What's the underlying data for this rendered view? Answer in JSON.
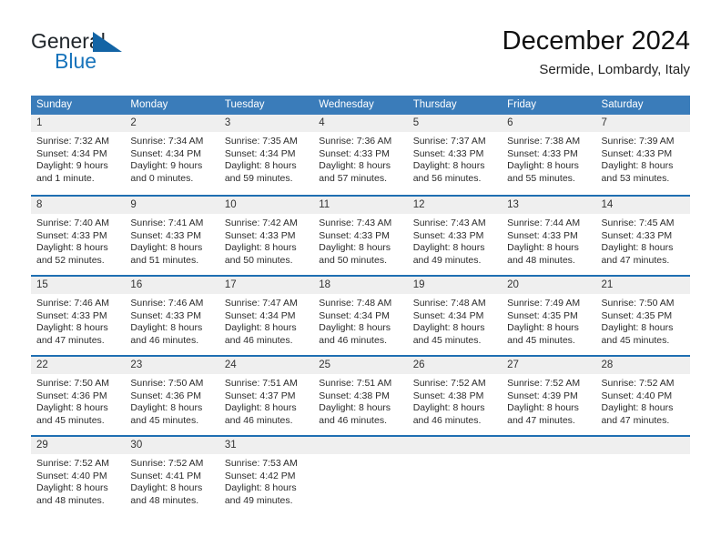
{
  "brand": {
    "name_part1": "General",
    "name_part2": "Blue",
    "mark_icon": "triangle-icon",
    "accent_color": "#1364a5"
  },
  "header": {
    "title": "December 2024",
    "subtitle": "Sermide, Lombardy, Italy"
  },
  "theme": {
    "header_row_bg": "#3a7cba",
    "row_divider": "#1f6fb2",
    "day_number_bg": "#efefef"
  },
  "weekdays": [
    "Sunday",
    "Monday",
    "Tuesday",
    "Wednesday",
    "Thursday",
    "Friday",
    "Saturday"
  ],
  "weeks": [
    [
      {
        "day": "1",
        "sunrise": "Sunrise: 7:32 AM",
        "sunset": "Sunset: 4:34 PM",
        "daylight1": "Daylight: 9 hours",
        "daylight2": "and 1 minute."
      },
      {
        "day": "2",
        "sunrise": "Sunrise: 7:34 AM",
        "sunset": "Sunset: 4:34 PM",
        "daylight1": "Daylight: 9 hours",
        "daylight2": "and 0 minutes."
      },
      {
        "day": "3",
        "sunrise": "Sunrise: 7:35 AM",
        "sunset": "Sunset: 4:34 PM",
        "daylight1": "Daylight: 8 hours",
        "daylight2": "and 59 minutes."
      },
      {
        "day": "4",
        "sunrise": "Sunrise: 7:36 AM",
        "sunset": "Sunset: 4:33 PM",
        "daylight1": "Daylight: 8 hours",
        "daylight2": "and 57 minutes."
      },
      {
        "day": "5",
        "sunrise": "Sunrise: 7:37 AM",
        "sunset": "Sunset: 4:33 PM",
        "daylight1": "Daylight: 8 hours",
        "daylight2": "and 56 minutes."
      },
      {
        "day": "6",
        "sunrise": "Sunrise: 7:38 AM",
        "sunset": "Sunset: 4:33 PM",
        "daylight1": "Daylight: 8 hours",
        "daylight2": "and 55 minutes."
      },
      {
        "day": "7",
        "sunrise": "Sunrise: 7:39 AM",
        "sunset": "Sunset: 4:33 PM",
        "daylight1": "Daylight: 8 hours",
        "daylight2": "and 53 minutes."
      }
    ],
    [
      {
        "day": "8",
        "sunrise": "Sunrise: 7:40 AM",
        "sunset": "Sunset: 4:33 PM",
        "daylight1": "Daylight: 8 hours",
        "daylight2": "and 52 minutes."
      },
      {
        "day": "9",
        "sunrise": "Sunrise: 7:41 AM",
        "sunset": "Sunset: 4:33 PM",
        "daylight1": "Daylight: 8 hours",
        "daylight2": "and 51 minutes."
      },
      {
        "day": "10",
        "sunrise": "Sunrise: 7:42 AM",
        "sunset": "Sunset: 4:33 PM",
        "daylight1": "Daylight: 8 hours",
        "daylight2": "and 50 minutes."
      },
      {
        "day": "11",
        "sunrise": "Sunrise: 7:43 AM",
        "sunset": "Sunset: 4:33 PM",
        "daylight1": "Daylight: 8 hours",
        "daylight2": "and 50 minutes."
      },
      {
        "day": "12",
        "sunrise": "Sunrise: 7:43 AM",
        "sunset": "Sunset: 4:33 PM",
        "daylight1": "Daylight: 8 hours",
        "daylight2": "and 49 minutes."
      },
      {
        "day": "13",
        "sunrise": "Sunrise: 7:44 AM",
        "sunset": "Sunset: 4:33 PM",
        "daylight1": "Daylight: 8 hours",
        "daylight2": "and 48 minutes."
      },
      {
        "day": "14",
        "sunrise": "Sunrise: 7:45 AM",
        "sunset": "Sunset: 4:33 PM",
        "daylight1": "Daylight: 8 hours",
        "daylight2": "and 47 minutes."
      }
    ],
    [
      {
        "day": "15",
        "sunrise": "Sunrise: 7:46 AM",
        "sunset": "Sunset: 4:33 PM",
        "daylight1": "Daylight: 8 hours",
        "daylight2": "and 47 minutes."
      },
      {
        "day": "16",
        "sunrise": "Sunrise: 7:46 AM",
        "sunset": "Sunset: 4:33 PM",
        "daylight1": "Daylight: 8 hours",
        "daylight2": "and 46 minutes."
      },
      {
        "day": "17",
        "sunrise": "Sunrise: 7:47 AM",
        "sunset": "Sunset: 4:34 PM",
        "daylight1": "Daylight: 8 hours",
        "daylight2": "and 46 minutes."
      },
      {
        "day": "18",
        "sunrise": "Sunrise: 7:48 AM",
        "sunset": "Sunset: 4:34 PM",
        "daylight1": "Daylight: 8 hours",
        "daylight2": "and 46 minutes."
      },
      {
        "day": "19",
        "sunrise": "Sunrise: 7:48 AM",
        "sunset": "Sunset: 4:34 PM",
        "daylight1": "Daylight: 8 hours",
        "daylight2": "and 45 minutes."
      },
      {
        "day": "20",
        "sunrise": "Sunrise: 7:49 AM",
        "sunset": "Sunset: 4:35 PM",
        "daylight1": "Daylight: 8 hours",
        "daylight2": "and 45 minutes."
      },
      {
        "day": "21",
        "sunrise": "Sunrise: 7:50 AM",
        "sunset": "Sunset: 4:35 PM",
        "daylight1": "Daylight: 8 hours",
        "daylight2": "and 45 minutes."
      }
    ],
    [
      {
        "day": "22",
        "sunrise": "Sunrise: 7:50 AM",
        "sunset": "Sunset: 4:36 PM",
        "daylight1": "Daylight: 8 hours",
        "daylight2": "and 45 minutes."
      },
      {
        "day": "23",
        "sunrise": "Sunrise: 7:50 AM",
        "sunset": "Sunset: 4:36 PM",
        "daylight1": "Daylight: 8 hours",
        "daylight2": "and 45 minutes."
      },
      {
        "day": "24",
        "sunrise": "Sunrise: 7:51 AM",
        "sunset": "Sunset: 4:37 PM",
        "daylight1": "Daylight: 8 hours",
        "daylight2": "and 46 minutes."
      },
      {
        "day": "25",
        "sunrise": "Sunrise: 7:51 AM",
        "sunset": "Sunset: 4:38 PM",
        "daylight1": "Daylight: 8 hours",
        "daylight2": "and 46 minutes."
      },
      {
        "day": "26",
        "sunrise": "Sunrise: 7:52 AM",
        "sunset": "Sunset: 4:38 PM",
        "daylight1": "Daylight: 8 hours",
        "daylight2": "and 46 minutes."
      },
      {
        "day": "27",
        "sunrise": "Sunrise: 7:52 AM",
        "sunset": "Sunset: 4:39 PM",
        "daylight1": "Daylight: 8 hours",
        "daylight2": "and 47 minutes."
      },
      {
        "day": "28",
        "sunrise": "Sunrise: 7:52 AM",
        "sunset": "Sunset: 4:40 PM",
        "daylight1": "Daylight: 8 hours",
        "daylight2": "and 47 minutes."
      }
    ],
    [
      {
        "day": "29",
        "sunrise": "Sunrise: 7:52 AM",
        "sunset": "Sunset: 4:40 PM",
        "daylight1": "Daylight: 8 hours",
        "daylight2": "and 48 minutes."
      },
      {
        "day": "30",
        "sunrise": "Sunrise: 7:52 AM",
        "sunset": "Sunset: 4:41 PM",
        "daylight1": "Daylight: 8 hours",
        "daylight2": "and 48 minutes."
      },
      {
        "day": "31",
        "sunrise": "Sunrise: 7:53 AM",
        "sunset": "Sunset: 4:42 PM",
        "daylight1": "Daylight: 8 hours",
        "daylight2": "and 49 minutes."
      },
      {
        "day": "",
        "sunrise": "",
        "sunset": "",
        "daylight1": "",
        "daylight2": ""
      },
      {
        "day": "",
        "sunrise": "",
        "sunset": "",
        "daylight1": "",
        "daylight2": ""
      },
      {
        "day": "",
        "sunrise": "",
        "sunset": "",
        "daylight1": "",
        "daylight2": ""
      },
      {
        "day": "",
        "sunrise": "",
        "sunset": "",
        "daylight1": "",
        "daylight2": ""
      }
    ]
  ]
}
